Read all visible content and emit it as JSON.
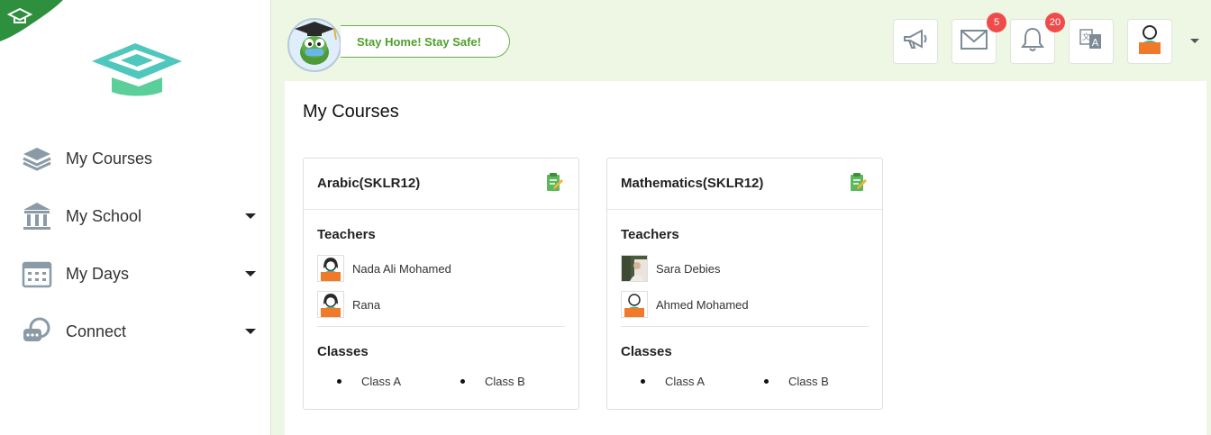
{
  "sidebar": {
    "items": [
      {
        "label": "My Courses",
        "icon": "books-stack-icon",
        "has_caret": false
      },
      {
        "label": "My School",
        "icon": "school-building-icon",
        "has_caret": true
      },
      {
        "label": "My Days",
        "icon": "calendar-icon",
        "has_caret": true
      },
      {
        "label": "Connect",
        "icon": "chat-bubble-icon",
        "has_caret": true
      }
    ]
  },
  "header": {
    "banner_text": "Stay Home! Stay Safe!",
    "buttons": [
      {
        "icon": "megaphone-icon"
      },
      {
        "icon": "mail-icon",
        "badge": "5"
      },
      {
        "icon": "bell-icon",
        "badge": "20"
      },
      {
        "icon": "translate-icon"
      },
      {
        "icon": "user-avatar-icon"
      }
    ]
  },
  "main": {
    "title": "My Courses",
    "courses": [
      {
        "name": "Arabic(SKLR12)",
        "teachers_label": "Teachers",
        "teachers": [
          "Nada Ali Mohamed",
          "Rana"
        ],
        "classes_label": "Classes",
        "classes": [
          "Class A",
          "Class B"
        ]
      },
      {
        "name": "Mathematics(SKLR12)",
        "teachers_label": "Teachers",
        "teachers": [
          "Sara Debies",
          "Ahmed Mohamed"
        ],
        "classes_label": "Classes",
        "classes": [
          "Class A",
          "Class B"
        ]
      }
    ]
  },
  "colors": {
    "accent_green": "#4ea02c",
    "header_bg": "#eef7e3",
    "logo_teal": "#3cbfb4",
    "badge_red": "#f04b4b",
    "avatar_orange": "#f07a2a"
  }
}
